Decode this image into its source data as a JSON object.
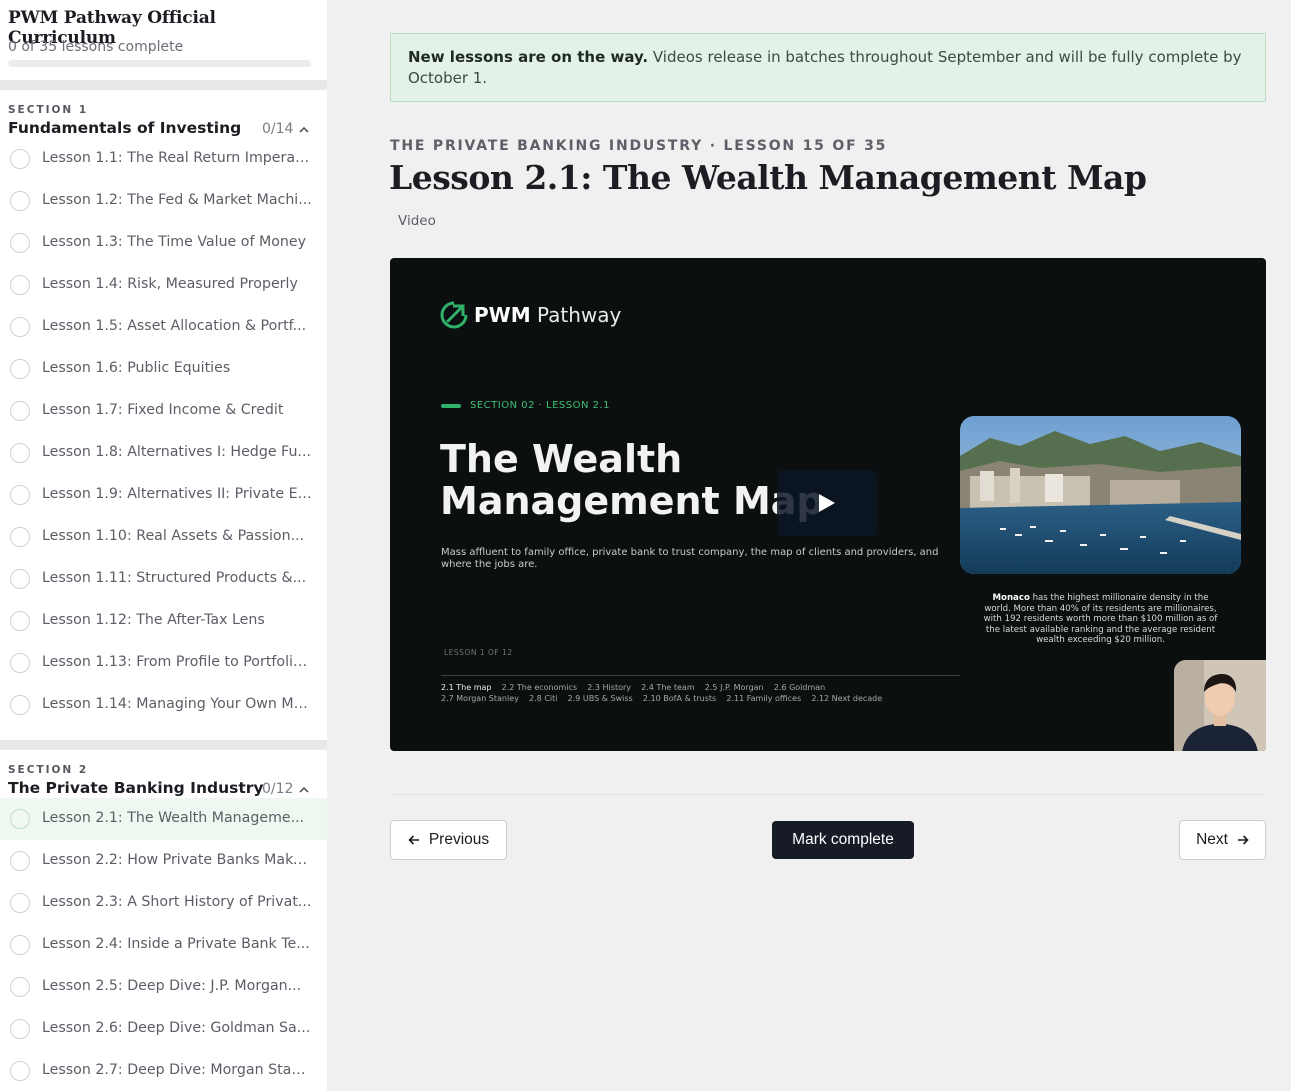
{
  "sidebar": {
    "course_title": "PWM Pathway Official Curriculum",
    "progress_text": "0 of 35 lessons complete",
    "progress_fraction": 0,
    "sections": [
      {
        "eyebrow": "SECTION 1",
        "title": "Fundamentals of Investing",
        "count": "0/14",
        "lessons": [
          "Lesson 1.1: The Real Return Imperati...",
          "Lesson 1.2: The Fed & Market Machi...",
          "Lesson 1.3: The Time Value of Money",
          "Lesson 1.4: Risk, Measured Properly",
          "Lesson 1.5: Asset Allocation & Portf...",
          "Lesson 1.6: Public Equities",
          "Lesson 1.7: Fixed Income & Credit",
          "Lesson 1.8: Alternatives I: Hedge Fu...",
          "Lesson 1.9: Alternatives II: Private Eq...",
          "Lesson 1.10: Real Assets & Passion...",
          "Lesson 1.11: Structured Products &...",
          "Lesson 1.12: The After-Tax Lens",
          "Lesson 1.13: From Profile to Portfolio...",
          "Lesson 1.14: Managing Your Own Mo..."
        ]
      },
      {
        "eyebrow": "SECTION 2",
        "title": "The Private Banking Industry",
        "count": "0/12",
        "lessons": [
          "Lesson 2.1: The Wealth Manageme...",
          "Lesson 2.2: How Private Banks Make...",
          "Lesson 2.3: A Short History of Privat...",
          "Lesson 2.4: Inside a Private Bank Te...",
          "Lesson 2.5: Deep Dive: J.P. Morgan...",
          "Lesson 2.6: Deep Dive: Goldman Sa...",
          "Lesson 2.7: Deep Dive: Morgan Stan..."
        ]
      }
    ]
  },
  "notice": {
    "bold": "New lessons are on the way.",
    "text": " Videos release in batches throughout September and will be fully complete by October 1."
  },
  "lesson": {
    "eyebrow": "THE PRIVATE BANKING INDUSTRY · LESSON 15 OF 35",
    "title": "Lesson 2.1: The Wealth Management Map",
    "type": "Video"
  },
  "video": {
    "brand_bold": "PWM",
    "brand_light": " Pathway",
    "kicker": "SECTION 02 · LESSON 2.1",
    "title_line1": "The Wealth",
    "title_line2": "Management Map",
    "subtitle": "Mass affluent to family office, private bank to trust company, the map of clients and providers, and where the jobs are.",
    "lesson_count": "LESSON 1 OF 12",
    "toc_row1": [
      "2.1 The map",
      "2.2 The economics",
      "2.3 History",
      "2.4 The team",
      "2.5 J.P. Morgan",
      "2.6 Goldman"
    ],
    "toc_row2": [
      "2.7 Morgan Stanley",
      "2.8 Citi",
      "2.9 UBS & Swiss",
      "2.10 BofA & trusts",
      "2.11 Family offices",
      "2.12 Next decade"
    ],
    "caption_bold": "Monaco",
    "caption_text": " has the highest millionaire density in the world. More than 40% of its residents are millionaires, with 192 residents worth more than $100 million as of the latest available ranking and the average resident wealth exceeding $20 million."
  },
  "nav": {
    "previous": "Previous",
    "mark_complete": "Mark complete",
    "next": "Next"
  },
  "colors": {
    "accent_green": "#2fb26a",
    "primary_button": "#171b26",
    "notice_bg": "#e3f1e6"
  }
}
